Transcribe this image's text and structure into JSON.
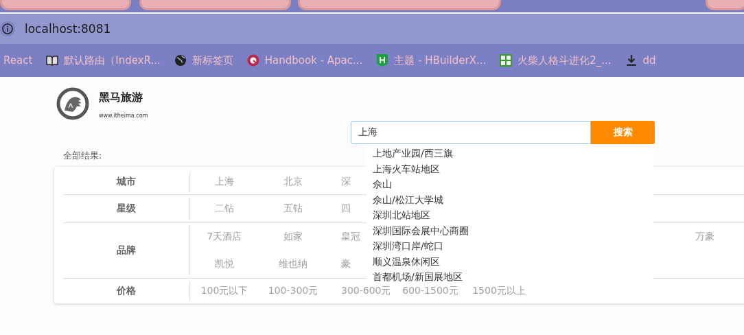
{
  "browser": {
    "address": "localhost:8081",
    "bookmarks": [
      {
        "kind": "none",
        "label": "React"
      },
      {
        "kind": "book",
        "label": "默认路由（IndexR..."
      },
      {
        "kind": "globe",
        "label": "新标签页"
      },
      {
        "kind": "badge",
        "label": "Handbook - Apac..."
      },
      {
        "kind": "letter",
        "label": "主题 - HBuilderX..."
      },
      {
        "kind": "grid",
        "label": "火柴人格斗进化2_..."
      },
      {
        "kind": "download",
        "label": "dd"
      }
    ]
  },
  "site": {
    "title": "黑马旅游",
    "url": "www.itheima.com"
  },
  "search": {
    "value": "上海",
    "button": "搜索",
    "suggestions": [
      "上地产业园/西三旗",
      "上海火车站地区",
      "佘山",
      "佘山/松江大学城",
      "深圳北站地区",
      "深圳国际会展中心商圈",
      "深圳湾口岸/蛇口",
      "顺义温泉休闲区",
      "首都机场/新国展地区"
    ]
  },
  "results_label": "全部结果:",
  "filters": [
    {
      "label": "城市",
      "lines": [
        [
          "上海",
          "北京",
          "深"
        ]
      ]
    },
    {
      "label": "星级",
      "lines": [
        [
          "二钻",
          "五钻",
          "四"
        ]
      ]
    },
    {
      "label": "品牌",
      "lines": [
        [
          "7天酒店",
          "如家",
          "皇冠",
          "万豪"
        ],
        [
          "凯悦",
          "维也纳",
          "豪"
        ]
      ]
    },
    {
      "label": "价格",
      "lines": [
        [
          "100元以下",
          "100-300元",
          "300-600元",
          "600-1500元",
          "1500元以上"
        ]
      ]
    }
  ]
}
